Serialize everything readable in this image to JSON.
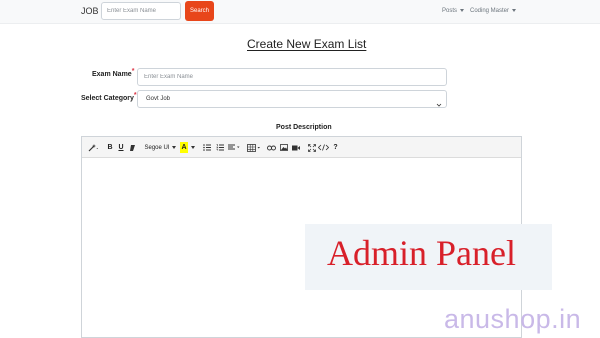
{
  "navbar": {
    "brand": "JOB",
    "search_placeholder": "Enter Exam Name",
    "search_button": "Search",
    "posts_menu": "Posts",
    "coding_master_menu": "Coding Master"
  },
  "page": {
    "title": "Create New Exam List"
  },
  "form": {
    "exam_name_label": "Exam Name",
    "exam_name_placeholder": "Enter Exam Name",
    "category_label": "Select Category",
    "category_value": "Govt Job",
    "required_mark": "*",
    "post_description_label": "Post Description"
  },
  "editor_toolbar": {
    "bold": "B",
    "underline": "U",
    "font_name": "Segoe UI",
    "font_color": "A",
    "help": "?"
  },
  "overlay": {
    "text": "Admin Panel",
    "text_color": "#d8202a"
  },
  "watermark": {
    "text": "anushop.in",
    "color": "#c9b9e8"
  },
  "colors": {
    "accent": "#e8461a",
    "required": "#dc3545"
  }
}
